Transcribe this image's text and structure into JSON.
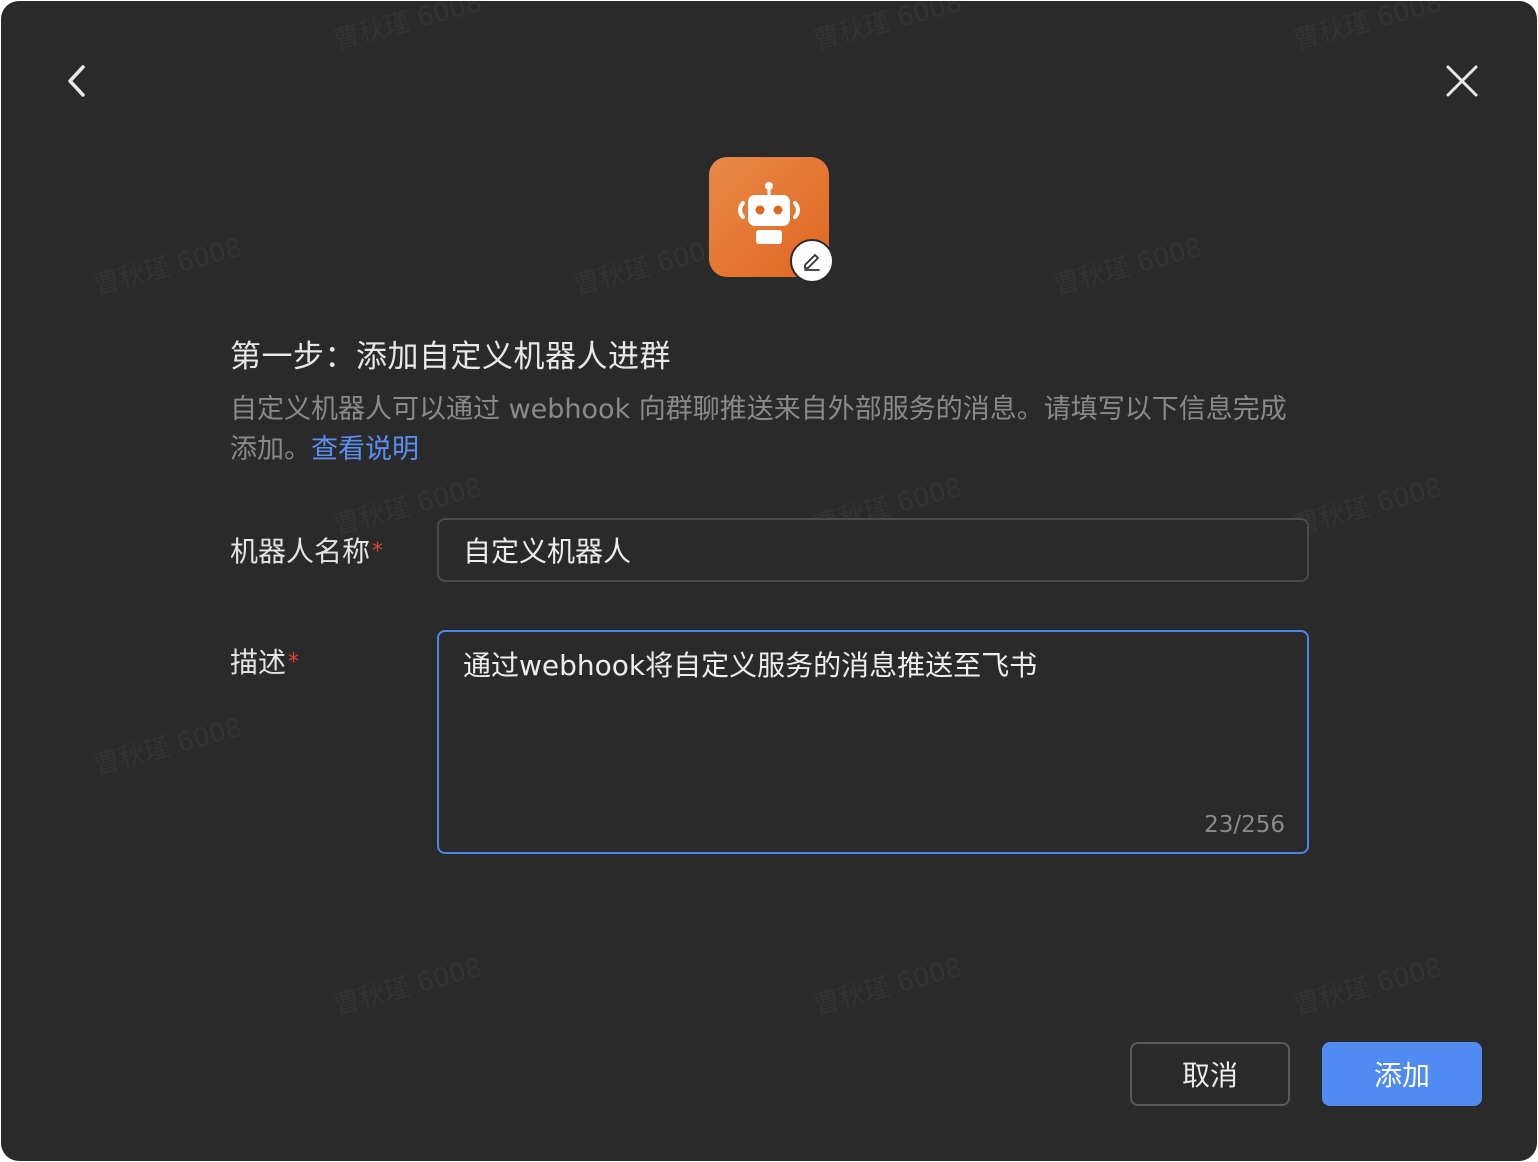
{
  "header": {
    "back_icon": "chevron-left-icon",
    "close_icon": "close-icon"
  },
  "avatar": {
    "icon": "robot-icon",
    "edit_icon": "pencil-icon",
    "gradient": [
      "#e8894a",
      "#e0661f"
    ]
  },
  "step": {
    "title": "第一步：添加自定义机器人进群",
    "description": "自定义机器人可以通过 webhook 向群聊推送来自外部服务的消息。请填写以下信息完成添加。",
    "help_link": "查看说明"
  },
  "form": {
    "name_label": "机器人名称",
    "name_value": "自定义机器人",
    "desc_label": "描述",
    "desc_value": "通过webhook将自定义服务的消息推送至飞书",
    "desc_counter": "23/256",
    "required_mark": "*"
  },
  "actions": {
    "cancel_label": "取消",
    "add_label": "添加"
  },
  "watermark": {
    "text": "曹秋瑾 6008"
  },
  "colors": {
    "background": "#2a2a2a",
    "accent": "#4f8bf0",
    "link": "#5a8ff0",
    "required": "#e0443a"
  }
}
